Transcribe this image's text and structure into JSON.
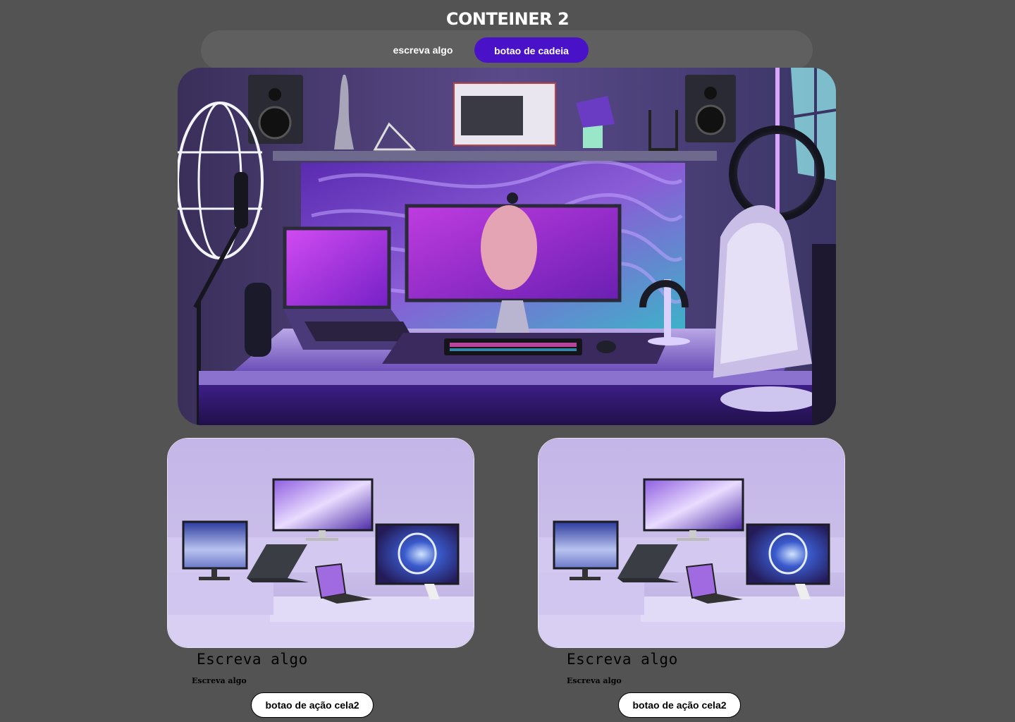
{
  "header": {
    "title": "CONTEINER 2"
  },
  "nav": {
    "text_label": "escreva algo",
    "button_label": "botao de cadeia",
    "button_color": "#4a12c8"
  },
  "hero": {
    "image_description_icon": "gaming-desk-setup-image",
    "accent_colors": [
      "#6b2bd6",
      "#2fb7c9",
      "#b25cff"
    ]
  },
  "cards": [
    {
      "image_icon": "monitors-display-image",
      "heading": "Escreva algo",
      "subtext": "Escreva algo",
      "button_label": "botao de ação cela2"
    },
    {
      "image_icon": "monitors-display-image",
      "heading": "Escreva algo",
      "subtext": "Escreva algo",
      "button_label": "botao de ação cela2"
    }
  ],
  "colors": {
    "page_background": "#535353",
    "pill_bar": "#5f5f5f",
    "card_background": "#c9bfe6"
  }
}
